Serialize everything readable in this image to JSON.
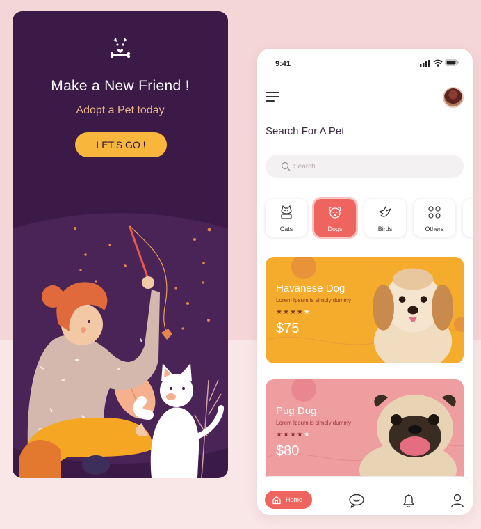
{
  "colors": {
    "left_bg": "#3b1a47",
    "accent_yellow": "#f8b73c",
    "accent_coral": "#f0645f",
    "card_orange": "#f5ab2b",
    "card_pink": "#ef9ea0"
  },
  "welcome": {
    "logo_icon": "dog-bone-logo-icon",
    "title": "Make a New Friend !",
    "subtitle": "Adopt a Pet today",
    "cta_label": "LET'S GO !"
  },
  "app": {
    "status_time": "9:41",
    "status_icons": [
      "signal-icon",
      "wifi-icon",
      "battery-icon"
    ],
    "menu_icon": "hamburger-menu-icon",
    "avatar_icon": "user-avatar",
    "page_title": "Search For A Pet",
    "search": {
      "placeholder": "Search",
      "value": ""
    },
    "categories": [
      {
        "label": "Cats",
        "icon": "cat-icon",
        "active": false
      },
      {
        "label": "Dogs",
        "icon": "dog-icon",
        "active": true
      },
      {
        "label": "Birds",
        "icon": "bird-icon",
        "active": false
      },
      {
        "label": "Others",
        "icon": "others-icon",
        "active": false
      }
    ],
    "pets": [
      {
        "name": "Havanese Dog",
        "description": "Lorem Ipsum is simply dummy",
        "rating": 4,
        "rating_max": 5,
        "price": "$75"
      },
      {
        "name": "Pug Dog",
        "description": "Lorem Ipsum is simply dummy",
        "rating": 4,
        "rating_max": 5,
        "price": "$80"
      }
    ],
    "nav": {
      "home_label": "Home",
      "items": [
        "home-icon",
        "chat-icon",
        "bell-icon",
        "profile-icon"
      ]
    }
  }
}
